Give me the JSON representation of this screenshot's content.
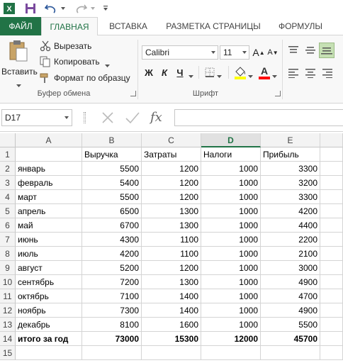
{
  "quick_access": {
    "app_icon": "excel-icon",
    "save_icon": "save-icon",
    "undo_icon": "undo-icon",
    "redo_icon": "redo-icon",
    "customize_icon": "customize-qat-icon"
  },
  "tabs": {
    "file": "ФАЙЛ",
    "home": "ГЛАВНАЯ",
    "insert": "ВСТАВКА",
    "page_layout": "РАЗМЕТКА СТРАНИЦЫ",
    "formulas": "ФОРМУЛЫ"
  },
  "clipboard": {
    "paste": "Вставить",
    "cut": "Вырезать",
    "copy": "Копировать",
    "format_painter": "Формат по образцу",
    "group_label": "Буфер обмена"
  },
  "font": {
    "name": "Calibri",
    "size": "11",
    "bold": "Ж",
    "italic": "К",
    "underline": "Ч",
    "grow": "A",
    "shrink": "A",
    "group_label": "Шрифт",
    "fill_color": "#ffff00",
    "font_color": "#ff0000"
  },
  "formula_bar": {
    "name_box": "D17",
    "fx": "fx",
    "value": ""
  },
  "grid": {
    "columns": [
      "A",
      "B",
      "C",
      "D",
      "E"
    ],
    "selected_column": "D",
    "rows": [
      {
        "n": "1",
        "cells": [
          "",
          "Выручка",
          "Затраты",
          "Налоги",
          "Прибыль"
        ]
      },
      {
        "n": "2",
        "cells": [
          "январь",
          "5500",
          "1200",
          "1000",
          "3300"
        ]
      },
      {
        "n": "3",
        "cells": [
          "февраль",
          "5400",
          "1200",
          "1000",
          "3200"
        ]
      },
      {
        "n": "4",
        "cells": [
          "март",
          "5500",
          "1200",
          "1000",
          "3300"
        ]
      },
      {
        "n": "5",
        "cells": [
          "апрель",
          "6500",
          "1300",
          "1000",
          "4200"
        ]
      },
      {
        "n": "6",
        "cells": [
          "май",
          "6700",
          "1300",
          "1000",
          "4400"
        ]
      },
      {
        "n": "7",
        "cells": [
          "июнь",
          "4300",
          "1100",
          "1000",
          "2200"
        ]
      },
      {
        "n": "8",
        "cells": [
          "июль",
          "4200",
          "1100",
          "1000",
          "2100"
        ]
      },
      {
        "n": "9",
        "cells": [
          "август",
          "5200",
          "1200",
          "1000",
          "3000"
        ]
      },
      {
        "n": "10",
        "cells": [
          "сентябрь",
          "7200",
          "1300",
          "1000",
          "4900"
        ]
      },
      {
        "n": "11",
        "cells": [
          "октябрь",
          "7100",
          "1400",
          "1000",
          "4700"
        ]
      },
      {
        "n": "12",
        "cells": [
          "ноябрь",
          "7300",
          "1400",
          "1000",
          "4900"
        ]
      },
      {
        "n": "13",
        "cells": [
          "декабрь",
          "8100",
          "1600",
          "1000",
          "5500"
        ]
      },
      {
        "n": "14",
        "cells": [
          "итого за год",
          "73000",
          "15300",
          "12000",
          "45700"
        ]
      },
      {
        "n": "15",
        "cells": [
          "",
          "",
          "",
          "",
          ""
        ]
      }
    ]
  },
  "colors": {
    "accent": "#217346",
    "ribbon_bg": "#f8f8f8"
  }
}
